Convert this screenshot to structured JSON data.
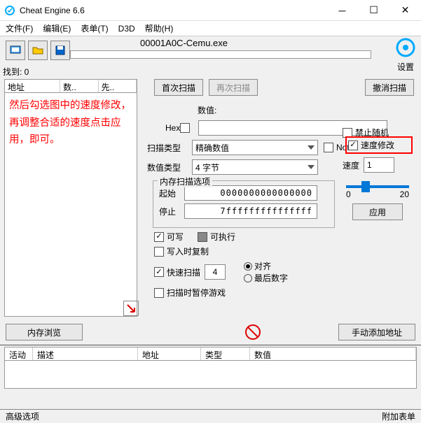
{
  "title": "Cheat Engine 6.6",
  "menu": {
    "file": "文件(F)",
    "edit": "编辑(E)",
    "table": "表单(T)",
    "d3d": "D3D",
    "help": "帮助(H)"
  },
  "process": "00001A0C-Cemu.exe",
  "settings_label": "设置",
  "found_label": "找到: 0",
  "list_header": {
    "addr": "地址",
    "val": "数..",
    "prev": "先.."
  },
  "overlay_note": "然后勾选图中的速度修改，再调整合适的速度点击应用，即可。",
  "scan": {
    "first": "首次扫描",
    "next": "再次扫描",
    "cancel": "撤消扫描",
    "value_label": "数值:",
    "hex_label": "Hex",
    "value": "",
    "scan_type_label": "扫描类型",
    "scan_type": "精确数值",
    "not_label": "Not",
    "val_type_label": "数值类型",
    "val_type": "4 字节"
  },
  "mem": {
    "legend": "内存扫描选项",
    "start_label": "起始",
    "start": "0000000000000000",
    "stop_label": "停止",
    "stop": "7fffffffffffffff",
    "writable": "可写",
    "executable": "可执行",
    "cow": "写入时复制",
    "fast_label": "快速扫描",
    "fast_val": "4",
    "align": "对齐",
    "lastdigit": "最后数字",
    "pause": "扫描时暂停游戏"
  },
  "speed": {
    "norandom": "禁止随机",
    "speedhack": "速度修改",
    "speed_label": "速度",
    "speed_val": "1",
    "min": "0",
    "max": "20",
    "apply": "应用"
  },
  "bottom": {
    "membrowse": "内存浏览",
    "addaddr": "手动添加地址"
  },
  "table": {
    "active": "活动",
    "desc": "描述",
    "addr": "地址",
    "type": "类型",
    "val": "数值"
  },
  "status": {
    "advanced": "高级选项",
    "tableextra": "附加表单"
  }
}
